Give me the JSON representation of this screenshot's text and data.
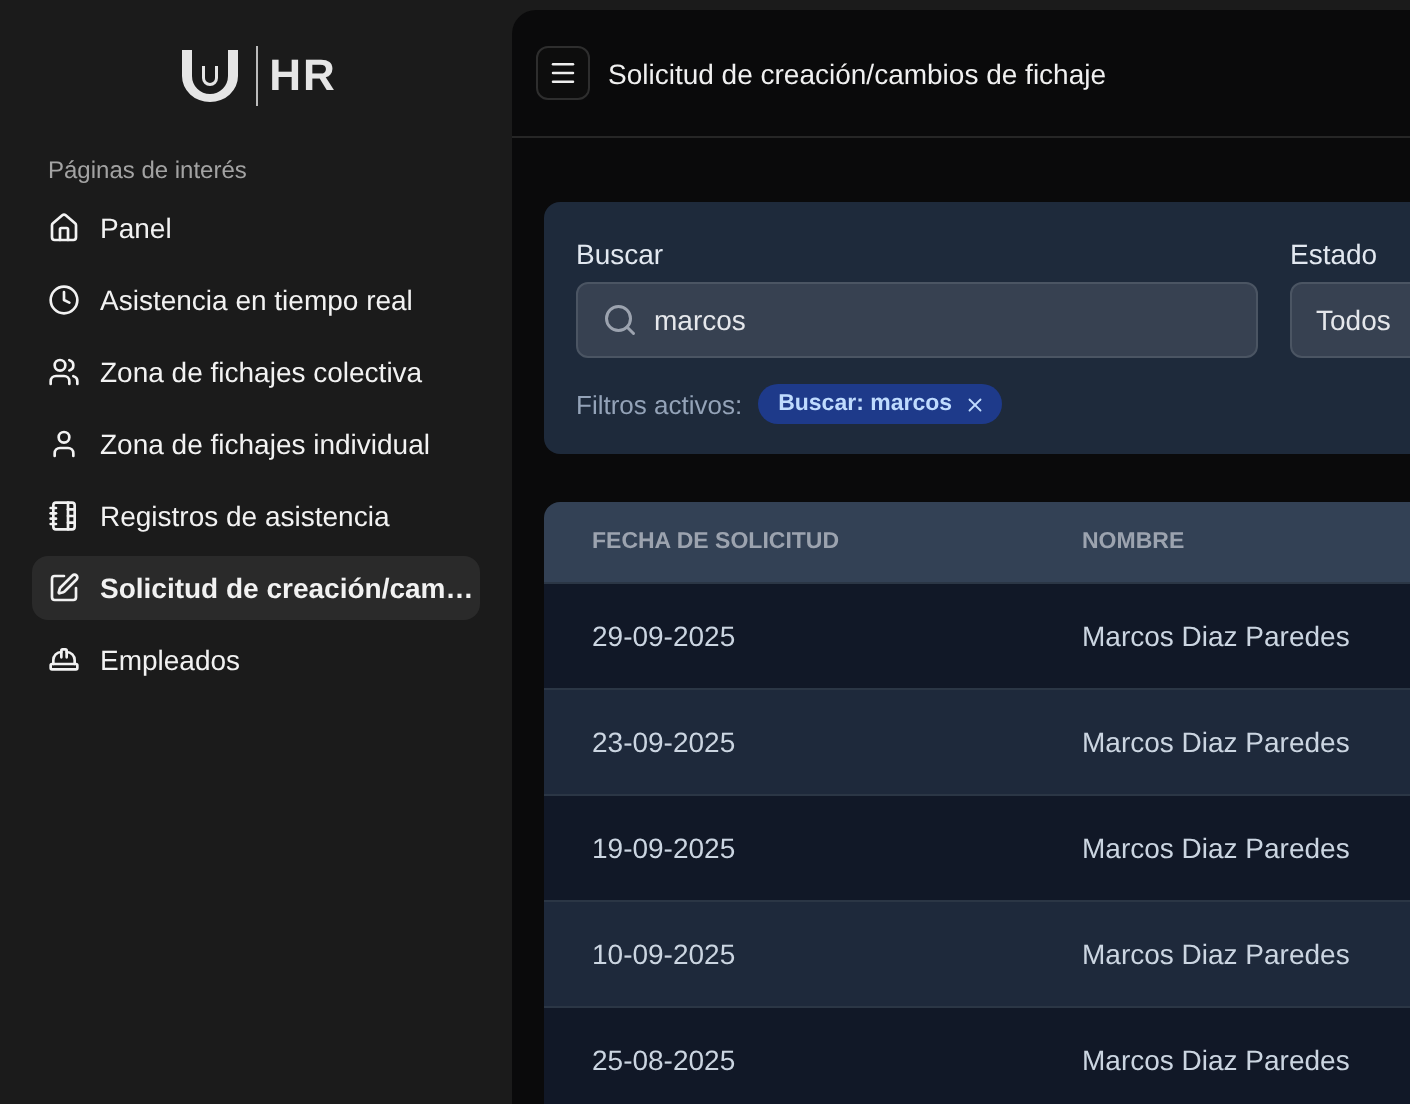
{
  "logo": {
    "text": "HR"
  },
  "sidebar": {
    "section_title": "Páginas de interés",
    "items": [
      {
        "label": "Panel",
        "selected": false
      },
      {
        "label": "Asistencia en tiempo real",
        "selected": false
      },
      {
        "label": "Zona de fichajes colectiva",
        "selected": false
      },
      {
        "label": "Zona de fichajes individual",
        "selected": false
      },
      {
        "label": "Registros de asistencia",
        "selected": false
      },
      {
        "label": "Solicitud de creación/cam…",
        "selected": true
      },
      {
        "label": "Empleados",
        "selected": false
      }
    ]
  },
  "header": {
    "title": "Solicitud de creación/cambios de fichaje"
  },
  "filters": {
    "search_label": "Buscar",
    "search_value": "marcos",
    "status_label": "Estado",
    "status_value": "Todos",
    "active_label": "Filtros activos:",
    "active_chips": [
      "Buscar: marcos"
    ]
  },
  "table": {
    "columns": [
      "FECHA DE SOLICITUD",
      "NOMBRE"
    ],
    "rows": [
      [
        "29-09-2025",
        "Marcos Diaz Paredes"
      ],
      [
        "23-09-2025",
        "Marcos Diaz Paredes"
      ],
      [
        "19-09-2025",
        "Marcos Diaz Paredes"
      ],
      [
        "10-09-2025",
        "Marcos Diaz Paredes"
      ],
      [
        "25-08-2025",
        "Marcos Diaz Paredes"
      ]
    ]
  }
}
